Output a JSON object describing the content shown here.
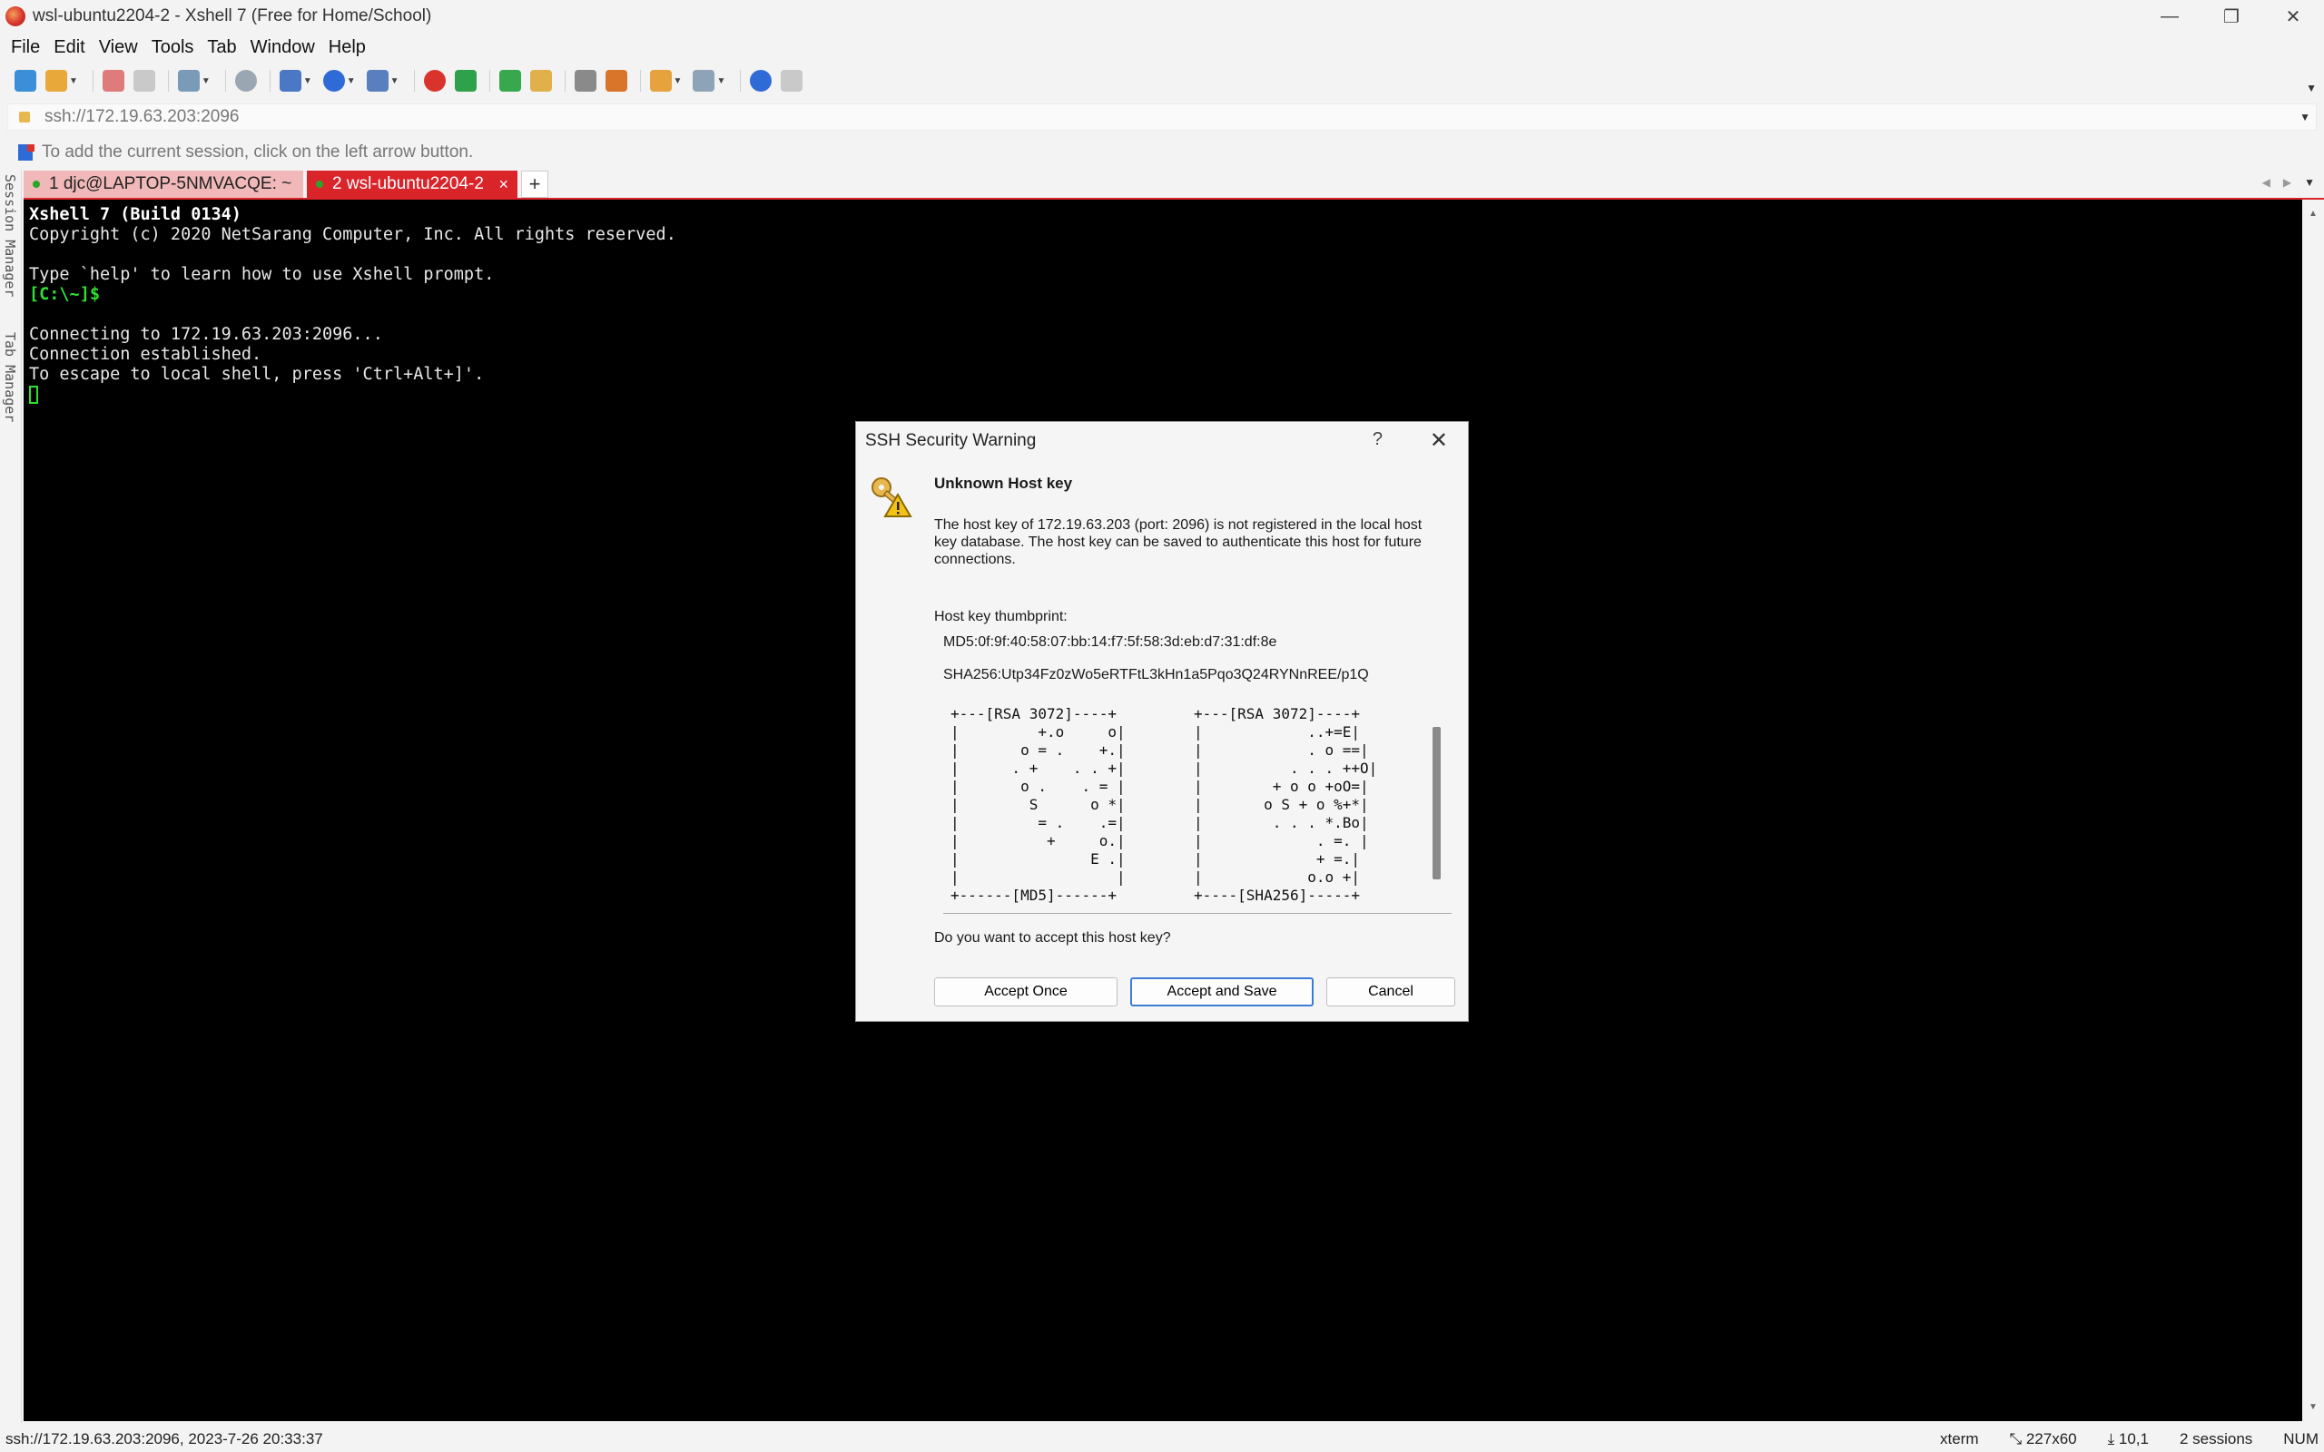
{
  "window": {
    "title": "wsl-ubuntu2204-2 - Xshell 7 (Free for Home/School)",
    "minimize": "—",
    "restore": "❐",
    "close": "✕"
  },
  "menu": [
    "File",
    "Edit",
    "View",
    "Tools",
    "Tab",
    "Window",
    "Help"
  ],
  "toolbar": {
    "icons": [
      "new-session-icon",
      "open-folder-icon",
      "connect-icon",
      "disconnect-icon",
      "reconnect-icon",
      "find-icon",
      "layout-icon",
      "globe-icon",
      "font-icon",
      "xshell-icon",
      "xftp-icon",
      "fullscreen-icon",
      "lock-icon",
      "keyboard-icon",
      "compose-icon",
      "script-icon",
      "layout-grid-icon",
      "help-icon",
      "chat-icon"
    ]
  },
  "address": {
    "value": "ssh://172.19.63.203:2096"
  },
  "hint": {
    "text": "To add the current session, click on the left arrow button."
  },
  "tabs": [
    {
      "label": "1 djc@LAPTOP-5NMVACQE: ~",
      "active": false
    },
    {
      "label": "2 wsl-ubuntu2204-2",
      "active": true,
      "close": "×"
    }
  ],
  "tab_new": "+",
  "side_labels": {
    "session_manager": "Session Manager",
    "tab_manager": "Tab Manager"
  },
  "terminal": {
    "lines": [
      "Xshell 7 (Build 0134)",
      "Copyright (c) 2020 NetSarang Computer, Inc. All rights reserved.",
      "",
      "Type `help' to learn how to use Xshell prompt.",
      "[C:\\~]$",
      "",
      "Connecting to 172.19.63.203:2096...",
      "Connection established.",
      "To escape to local shell, press 'Ctrl+Alt+]'."
    ]
  },
  "status": {
    "left": "ssh://172.19.63.203:2096, 2023-7-26 20:33:37",
    "terminal_type": "xterm",
    "size": "227x60",
    "cursor_pos": "10,1",
    "sessions": "2 sessions",
    "num": "NUM"
  },
  "dialog": {
    "title": "SSH Security Warning",
    "help": "?",
    "close": "✕",
    "heading": "Unknown Host key",
    "description": "The host key of 172.19.63.203 (port: 2096) is not registered in the local host key database. The host key can be saved to authenticate this host for future connections.",
    "thumbprint_label": "Host key thumbprint:",
    "md5": "MD5:0f:9f:40:58:07:bb:14:f7:5f:58:3d:eb:d7:31:df:8e",
    "sha256": "SHA256:Utp34Fz0zWo5eRTFtL3kHn1a5Pqo3Q24RYNnREE/p1Q",
    "art_md5": "+---[RSA 3072]----+\n|         +.o     o|\n|       o = .    +.|\n|      . +    . . +|\n|       o .    . = |\n|        S      o *|\n|         = .    .=|\n|          +     o.|\n|               E .|\n|                  |\n+------[MD5]------+",
    "art_sha256": "+---[RSA 3072]----+\n|            ..+=E|\n|            . o ==|\n|          . . . ++O|\n|        + o o +oO=|\n|       o S + o %+*|\n|        . . . *.Bo|\n|             . =. |\n|             + =.|\n|            o.o +|\n+----[SHA256]-----+",
    "question": "Do you want to accept this host key?",
    "buttons": {
      "accept_once": "Accept Once",
      "accept_save": "Accept and Save",
      "cancel": "Cancel"
    }
  }
}
